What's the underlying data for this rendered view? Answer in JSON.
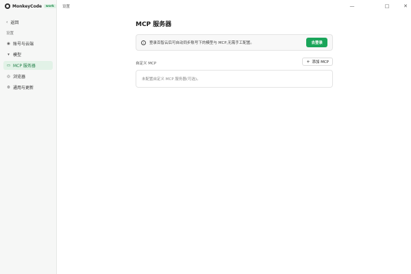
{
  "app": {
    "name": "MonkeyCode",
    "badge": "work"
  },
  "sidebar": {
    "back_label": "返回",
    "section_label": "设置",
    "items": [
      {
        "label": "账号与云端",
        "icon": "user-circle-icon",
        "active": false
      },
      {
        "label": "模型",
        "icon": "chevron-down-icon",
        "active": false
      },
      {
        "label": "MCP 服务器",
        "icon": "monitor-icon",
        "active": true
      },
      {
        "label": "浏览器",
        "icon": "globe-icon",
        "active": false
      },
      {
        "label": "通用与更新",
        "icon": "gear-icon",
        "active": false
      }
    ]
  },
  "topbar": {
    "breadcrumb": "设置"
  },
  "main": {
    "title": "MCP 服务器",
    "banner": {
      "text": "登录百智云后可自动同步账号下的模型与 MCP,无需手工配置。",
      "button_label": "去登录"
    },
    "custom_section": {
      "label": "自定义 MCP",
      "add_button_label": "添加 MCP",
      "empty_text": "未配置自定义 MCP 服务器(可选)。"
    }
  },
  "colors": {
    "accent": "#1aa55a",
    "active_bg": "#e2f2e7",
    "sidebar_bg": "#f6f7f6"
  }
}
